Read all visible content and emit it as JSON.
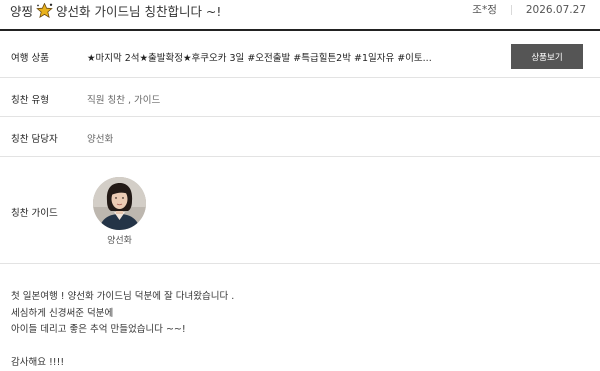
{
  "header": {
    "title_prefix": "양찡",
    "title_text": "양선화 가이드님 칭찬합니다 ~!",
    "author": "조*정",
    "date": "2026.07.27"
  },
  "rows": {
    "product": {
      "label": "여행 상품",
      "value": "★마지막 2석★출발확정★후쿠오카 3일 #오전출발 #특급힐튼2박 #1일자유 #이토...",
      "button_label": "상품보기"
    },
    "type": {
      "label": "칭찬 유형",
      "value": "직원 칭찬 , 가이드"
    },
    "staff": {
      "label": "칭찬 담당자",
      "value": "양선화"
    },
    "guide": {
      "label": "칭찬 가이드",
      "name": "양선화"
    }
  },
  "body": {
    "line1": "첫 일본여행 ! 양선화 가이드님 덕분에 잘 다녀왔습니다 .",
    "line2": "세심하게 신경써준 덕분에",
    "line3": "아이들 데리고 좋은 추억 만들었습니다 ~~!",
    "line4": "감사해요 !!!!"
  },
  "colors": {
    "accent_rule": "#222222",
    "button_bg": "#555555",
    "divider": "#e3e3e3"
  },
  "icons": {
    "title_icon": "sparkle-star-icon"
  }
}
